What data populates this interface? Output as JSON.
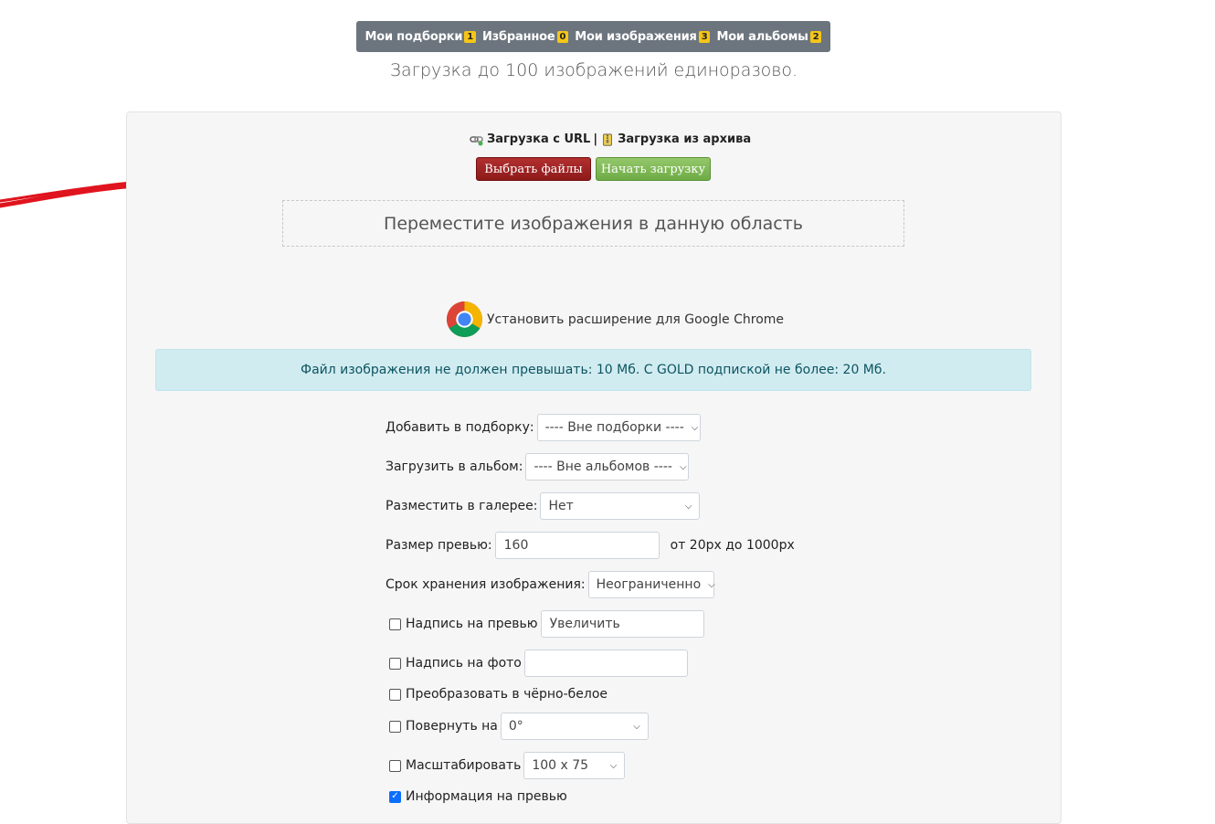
{
  "nav": {
    "items": [
      {
        "label": "Мои подборки",
        "badge": "1"
      },
      {
        "label": "Избранное",
        "badge": "0"
      },
      {
        "label": "Мои изображения",
        "badge": "3"
      },
      {
        "label": "Мои альбомы",
        "badge": "2"
      }
    ]
  },
  "subtitle": "Загрузка до 100 изображений единоразово.",
  "upload": {
    "url_link": "Загрузка с URL",
    "separator": "|",
    "archive_link": "Загрузка из архива",
    "choose_button": "Выбрать файлы",
    "start_button": "Начать загрузку",
    "dropzone": "Переместите изображения в данную область"
  },
  "chrome": {
    "label": "Установить расширение для Google Chrome"
  },
  "alert": "Файл изображения не должен превышать: 10 Мб. С GOLD подпиской не более: 20 Мб.",
  "form": {
    "collection_label": "Добавить в подборку:",
    "collection_value": "---- Вне подборки ----",
    "album_label": "Загрузить в альбом:",
    "album_value": "---- Вне альбомов ----",
    "gallery_label": "Разместить в галерее:",
    "gallery_value": "Нет",
    "preview_size_label": "Размер превью:",
    "preview_size_value": "160",
    "preview_size_hint": "от 20px до 1000px",
    "storage_label": "Срок хранения изображения:",
    "storage_value": "Неограниченно",
    "preview_caption_label": "Надпись на превью",
    "preview_caption_value": "Увеличить",
    "photo_caption_label": "Надпись на фото",
    "photo_caption_value": "",
    "bw_label": "Преобразовать в чёрно-белое",
    "rotate_label": "Повернуть на",
    "rotate_value": "0°",
    "scale_label": "Масштабировать",
    "scale_value": "100 x 75",
    "info_label": "Информация на превью"
  },
  "colors": {
    "nav_bg": "#6c757d",
    "badge": "#f5c518",
    "choose_button": "#9e2424",
    "start_button": "#7fb956",
    "alert_bg": "#d1ecf1",
    "annotation_arrow": "#e0141e"
  }
}
